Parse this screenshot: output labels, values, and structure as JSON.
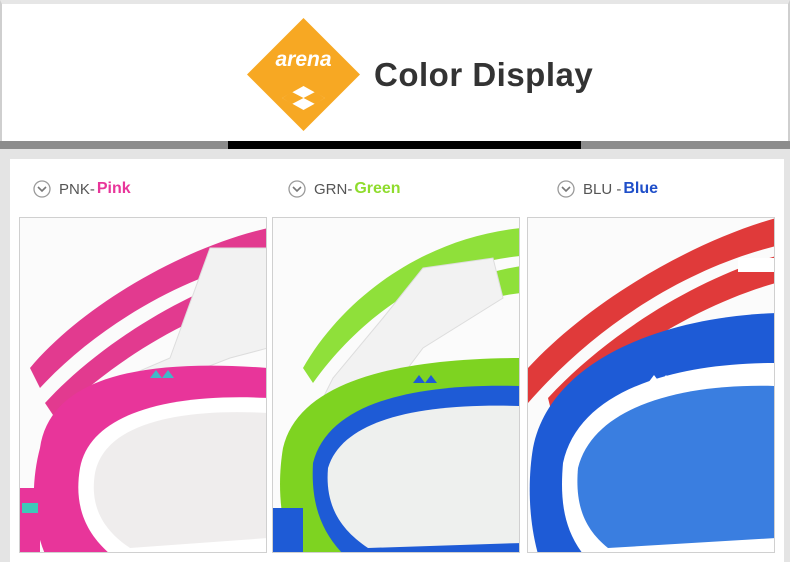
{
  "header": {
    "logo_text": "arena",
    "title": "Color Display"
  },
  "colors": {
    "logo_orange": "#f7a823",
    "divider_gray": "#8c8c8c",
    "divider_black": "#000000",
    "pink": "#e8359a",
    "green": "#8fdc2d",
    "blue": "#1f4fc9"
  },
  "variants": [
    {
      "code": "PNK-",
      "name": "Pink",
      "name_color": "#e8359a",
      "strap": "#e23a8f",
      "frame": "#e8359a",
      "lens": "#f0eeee"
    },
    {
      "code": "GRN- ",
      "name": "Green",
      "name_color": "#8fdc2d",
      "strap": "#8fe03a",
      "frame": "#7ed321",
      "lens": "#eef0ee"
    },
    {
      "code": "BLU - ",
      "name": "Blue",
      "name_color": "#1f4fc9",
      "strap": "#e03a3a",
      "frame": "#1e5bd6",
      "lens": "#3a7ee0"
    }
  ],
  "icons": {
    "label_icon": "chevron-down-circle-icon"
  }
}
